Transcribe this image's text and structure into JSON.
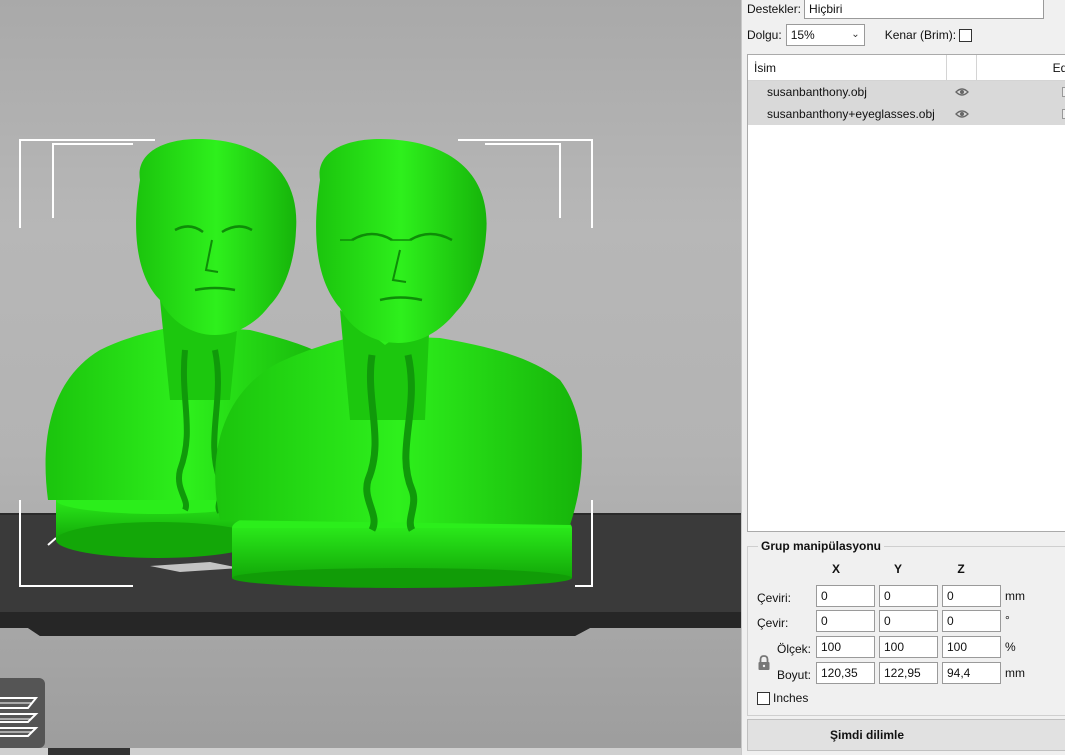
{
  "settings": {
    "supports_label": "Destekler:",
    "supports_value": "Hiçbiri",
    "infill_label": "Dolgu:",
    "infill_value": "15%",
    "brim_label": "Kenar (Brim):",
    "brim_checked": false
  },
  "object_list": {
    "columns": [
      "İsim",
      "",
      "Edi"
    ],
    "items": [
      {
        "name": "susanbanthony.obj",
        "visible": true
      },
      {
        "name": "susanbanthony+eyeglasses.obj",
        "visible": true
      }
    ]
  },
  "group_manipulation": {
    "title": "Grup manipülasyonu",
    "axes": [
      "X",
      "Y",
      "Z"
    ],
    "translate": {
      "label": "Çeviri:",
      "values": [
        "0",
        "0",
        "0"
      ],
      "unit": "mm"
    },
    "rotate": {
      "label": "Çevir:",
      "values": [
        "0",
        "0",
        "0"
      ],
      "unit": "°"
    },
    "scale": {
      "label": "Ölçek:",
      "values": [
        "100",
        "100",
        "100"
      ],
      "unit": "%"
    },
    "size": {
      "label": "Boyut:",
      "values": [
        "120,35",
        "122,95",
        "94,4"
      ],
      "unit": "mm"
    },
    "inches_label": "Inches",
    "inches_checked": false
  },
  "slice_button": {
    "label": "Şimdi dilimle"
  },
  "colors": {
    "model": "#22dd11",
    "model_shadow": "#129a09",
    "bed": "#3a3a3a",
    "panel_bg": "#f0f0f0",
    "row_selected": "#d9d9d9"
  }
}
